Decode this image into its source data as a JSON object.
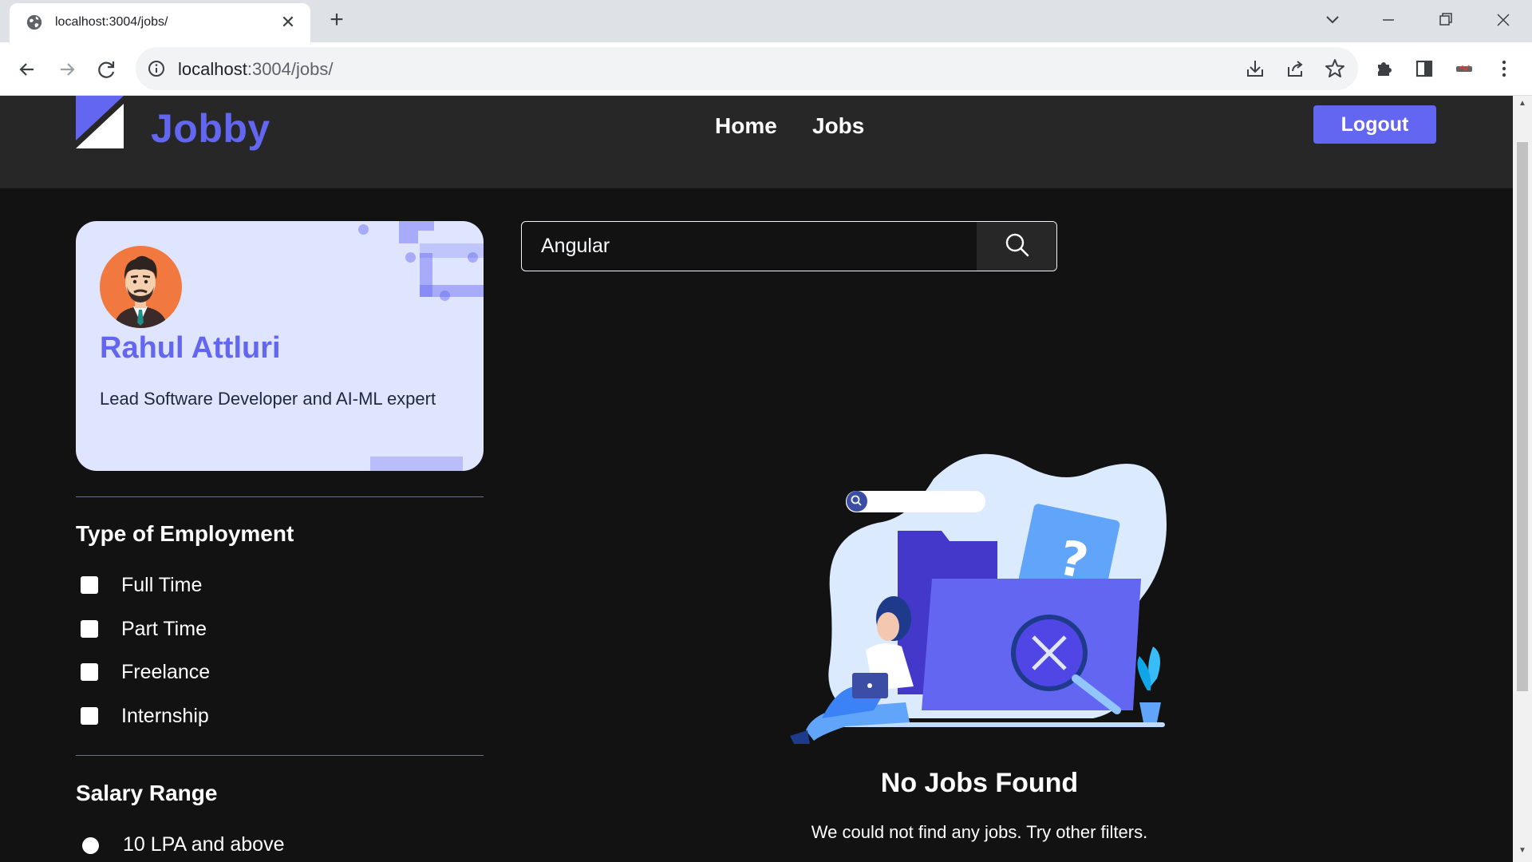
{
  "browser": {
    "tab_title": "localhost:3004/jobs/",
    "url_host": "localhost",
    "url_path": ":3004/jobs/"
  },
  "header": {
    "brand": "Jobby",
    "nav": [
      "Home",
      "Jobs"
    ],
    "logout_label": "Logout"
  },
  "profile": {
    "name": "Rahul Attluri",
    "bio": "Lead Software Developer and AI-ML expert"
  },
  "filters": {
    "employment_heading": "Type of Employment",
    "employment_options": [
      "Full Time",
      "Part Time",
      "Freelance",
      "Internship"
    ],
    "salary_heading": "Salary Range",
    "salary_options": [
      "10 LPA and above"
    ]
  },
  "search": {
    "value": "Angular"
  },
  "empty_state": {
    "title": "No Jobs Found",
    "message": "We could not find any jobs. Try other filters."
  },
  "colors": {
    "accent": "#6366f1",
    "header_bg": "#272727",
    "page_bg": "#121212",
    "profile_bg": "#dfe4ff"
  }
}
